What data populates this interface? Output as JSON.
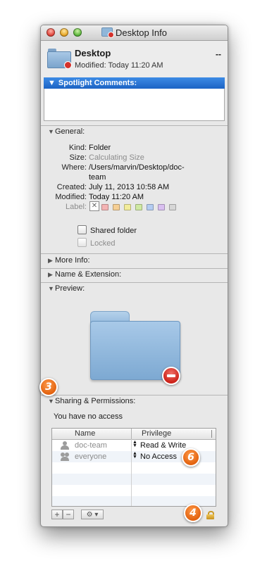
{
  "window": {
    "title": "Desktop Info"
  },
  "header": {
    "name": "Desktop",
    "modified": "Modified: Today 11:20 AM",
    "size": "--"
  },
  "spotlight": {
    "label": "Spotlight Comments:",
    "text": ""
  },
  "general": {
    "label": "General:",
    "kind_label": "Kind:",
    "kind": "Folder",
    "size_label": "Size:",
    "size": "Calculating Size",
    "where_label": "Where:",
    "where_line1": "/Users/marvin/Desktop/doc-",
    "where_line2": "team",
    "created_label": "Created:",
    "created": "July 11, 2013 10:58 AM",
    "modified_label": "Modified:",
    "modified": "Today 11:20 AM",
    "label_label": "Label:",
    "label_colors": [
      "#f4b3b3",
      "#f6cf95",
      "#f2ec9b",
      "#cfe9a2",
      "#b4ccf2",
      "#d9bff0",
      "#d6d6d6"
    ],
    "shared_folder": "Shared folder",
    "locked": "Locked"
  },
  "sections": {
    "more_info": "More Info:",
    "name_ext": "Name & Extension:",
    "preview": "Preview:",
    "sharing": "Sharing & Permissions:"
  },
  "permissions": {
    "note": "You have no access",
    "col_name": "Name",
    "col_privilege": "Privilege",
    "rows": [
      {
        "name": "doc-team",
        "privilege": "Read & Write",
        "icon": "user-icon"
      },
      {
        "name": "everyone",
        "privilege": "No Access",
        "icon": "group-icon"
      }
    ]
  },
  "toolbar": {
    "add": "+",
    "remove": "−",
    "action": "⚙ ▾"
  },
  "annotations": {
    "badge_3": "3",
    "badge_4": "4",
    "badge_6": "6"
  },
  "colors": {
    "accent": "#1c63c4",
    "badge": "#e2620f"
  }
}
